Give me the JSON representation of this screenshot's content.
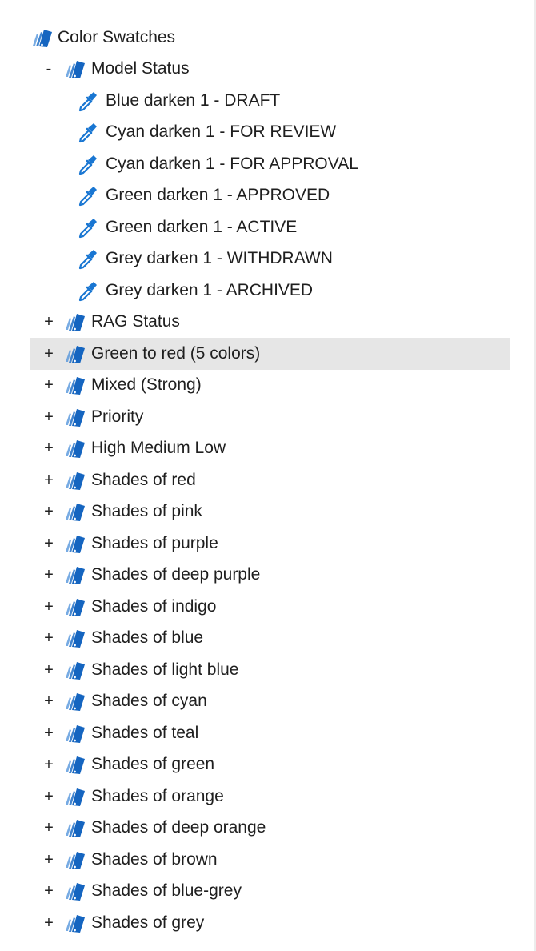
{
  "tree": {
    "root": {
      "label": "Color Swatches",
      "icon": "palette-icon"
    },
    "groups": [
      {
        "label": "Model Status",
        "toggle": "-",
        "expanded": true,
        "swatches": [
          {
            "label": "Blue darken 1 - DRAFT"
          },
          {
            "label": "Cyan darken 1 - FOR REVIEW"
          },
          {
            "label": "Cyan darken 1 - FOR APPROVAL"
          },
          {
            "label": "Green darken 1 - APPROVED"
          },
          {
            "label": "Green darken 1 - ACTIVE"
          },
          {
            "label": "Grey darken 1 - WITHDRAWN"
          },
          {
            "label": "Grey darken 1 - ARCHIVED"
          }
        ]
      },
      {
        "label": "RAG Status",
        "toggle": "+"
      },
      {
        "label": "Green to red (5 colors)",
        "toggle": "+",
        "selected": true
      },
      {
        "label": "Mixed (Strong)",
        "toggle": "+"
      },
      {
        "label": "Priority",
        "toggle": "+"
      },
      {
        "label": "High Medium Low",
        "toggle": "+"
      },
      {
        "label": "Shades of red",
        "toggle": "+"
      },
      {
        "label": "Shades of pink",
        "toggle": "+"
      },
      {
        "label": "Shades of purple",
        "toggle": "+"
      },
      {
        "label": "Shades of deep purple",
        "toggle": "+"
      },
      {
        "label": "Shades of indigo",
        "toggle": "+"
      },
      {
        "label": "Shades of blue",
        "toggle": "+"
      },
      {
        "label": "Shades of light blue",
        "toggle": "+"
      },
      {
        "label": "Shades of cyan",
        "toggle": "+"
      },
      {
        "label": "Shades of teal",
        "toggle": "+"
      },
      {
        "label": "Shades of green",
        "toggle": "+"
      },
      {
        "label": "Shades of orange",
        "toggle": "+"
      },
      {
        "label": "Shades of deep orange",
        "toggle": "+"
      },
      {
        "label": "Shades of brown",
        "toggle": "+"
      },
      {
        "label": "Shades of blue-grey",
        "toggle": "+"
      },
      {
        "label": "Shades of grey",
        "toggle": "+"
      }
    ]
  },
  "icons": {
    "group": "palette-icon",
    "swatch": "eyedropper-icon"
  },
  "colors": {
    "icon_blue": "#1976d2",
    "selected_row": "#e6e6e6",
    "text": "#1f1f1f"
  }
}
